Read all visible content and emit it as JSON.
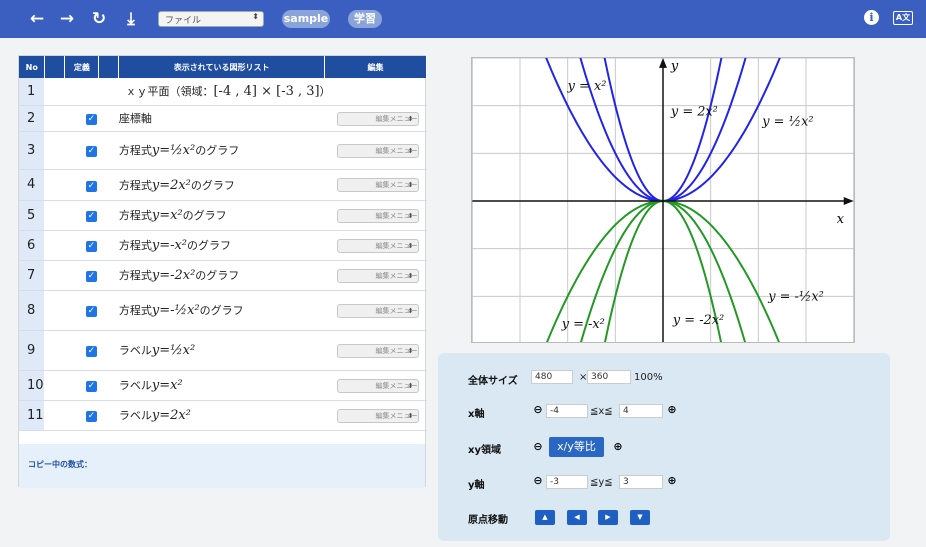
{
  "toolbar": {
    "file_select": "ファイル",
    "sample_label": "sample",
    "learn_label": "学習",
    "info_label": "i",
    "lang_label": "A文"
  },
  "table": {
    "headers": {
      "no": "No",
      "def": "定義",
      "list": "表示されている図形リスト",
      "edit": "編集"
    },
    "edit_menu_label": "編集メニュー",
    "row1_text": "ｘｙ平面（領域：",
    "row1_domain": "[-4 , 4] × [-3 , 3]",
    "row1_close": "）",
    "rows": [
      {
        "no": "1"
      },
      {
        "no": "2",
        "text": "座標軸"
      },
      {
        "no": "3",
        "prefix": "方程式",
        "suffix": "のグラフ"
      },
      {
        "no": "4",
        "prefix": "方程式",
        "suffix": "のグラフ"
      },
      {
        "no": "5",
        "prefix": "方程式",
        "suffix": "のグラフ"
      },
      {
        "no": "6",
        "prefix": "方程式",
        "suffix": "のグラフ"
      },
      {
        "no": "7",
        "prefix": "方程式",
        "suffix": "のグラフ"
      },
      {
        "no": "8",
        "prefix": "方程式",
        "suffix": "のグラフ"
      },
      {
        "no": "9",
        "prefix": "ラベル",
        "suffix": ""
      },
      {
        "no": "10",
        "prefix": "ラベル",
        "suffix": ""
      },
      {
        "no": "11",
        "prefix": "ラベル",
        "suffix": ""
      }
    ],
    "copy_label": "コピー中の数式："
  },
  "graph": {
    "x_label": "x",
    "y_label": "y",
    "labels": {
      "a": "y = x²",
      "b": "y = 2x²",
      "c": "y = ½x²",
      "d": "y = -x²",
      "e": "y = -2x²",
      "f": "y = -½x²"
    },
    "colors": {
      "positive": "#2222ee",
      "negative": "#229922"
    }
  },
  "controls": {
    "size_label": "全体サイズ",
    "width": "480",
    "times": "×",
    "height": "360",
    "percent": "100%",
    "x_axis_label": "x軸",
    "x_min": "-4",
    "x_rel": "≦x≦",
    "x_max": "4",
    "xy_label": "xy領域",
    "ratio_label": "x/y等比",
    "y_axis_label": "y軸",
    "y_min": "-3",
    "y_rel": "≦y≦",
    "y_max": "3",
    "origin_label": "原点移動"
  }
}
